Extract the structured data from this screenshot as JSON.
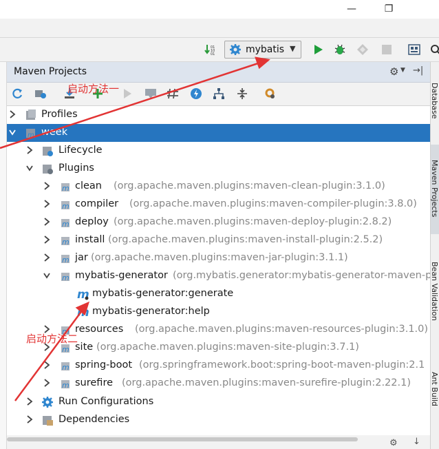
{
  "titlebar": {
    "minimize": "—",
    "maximize": "❐"
  },
  "toolbar": {
    "run_config": "mybatis",
    "colors": {
      "run": "#1f9e3a",
      "debug": "#2aa84a",
      "accent": "#2675bf"
    }
  },
  "panel": {
    "title": "Maven Projects"
  },
  "tree": {
    "profiles": "Profiles",
    "project": "week",
    "lifecycle": "Lifecycle",
    "plugins": "Plugins",
    "plugin_items": [
      {
        "name": "clean",
        "detail": "(org.apache.maven.plugins:maven-clean-plugin:3.1.0)"
      },
      {
        "name": "compiler",
        "detail": "(org.apache.maven.plugins:maven-compiler-plugin:3.8.0)"
      },
      {
        "name": "deploy",
        "detail": "(org.apache.maven.plugins:maven-deploy-plugin:2.8.2)"
      },
      {
        "name": "install",
        "detail": "(org.apache.maven.plugins:maven-install-plugin:2.5.2)"
      },
      {
        "name": "jar",
        "detail": "(org.apache.maven.plugins:maven-jar-plugin:3.1.1)"
      },
      {
        "name": "mybatis-generator",
        "detail": "(org.mybatis.generator:mybatis-generator-maven-p"
      }
    ],
    "goals": [
      "mybatis-generator:generate",
      "mybatis-generator:help"
    ],
    "plugin_items_after": [
      {
        "name": "resources",
        "detail": "(org.apache.maven.plugins:maven-resources-plugin:3.1.0)"
      },
      {
        "name": "site",
        "detail": "(org.apache.maven.plugins:maven-site-plugin:3.7.1)"
      },
      {
        "name": "spring-boot",
        "detail": "(org.springframework.boot:spring-boot-maven-plugin:2.1"
      },
      {
        "name": "surefire",
        "detail": "(org.apache.maven.plugins:maven-surefire-plugin:2.22.1)"
      }
    ],
    "run_configurations": "Run Configurations",
    "dependencies": "Dependencies"
  },
  "right_tabs": [
    "Database",
    "Maven Projects",
    "Bean Validation",
    "Ant Build"
  ],
  "annotations": {
    "method1": "启动方法一",
    "method2": "启动方法二"
  }
}
